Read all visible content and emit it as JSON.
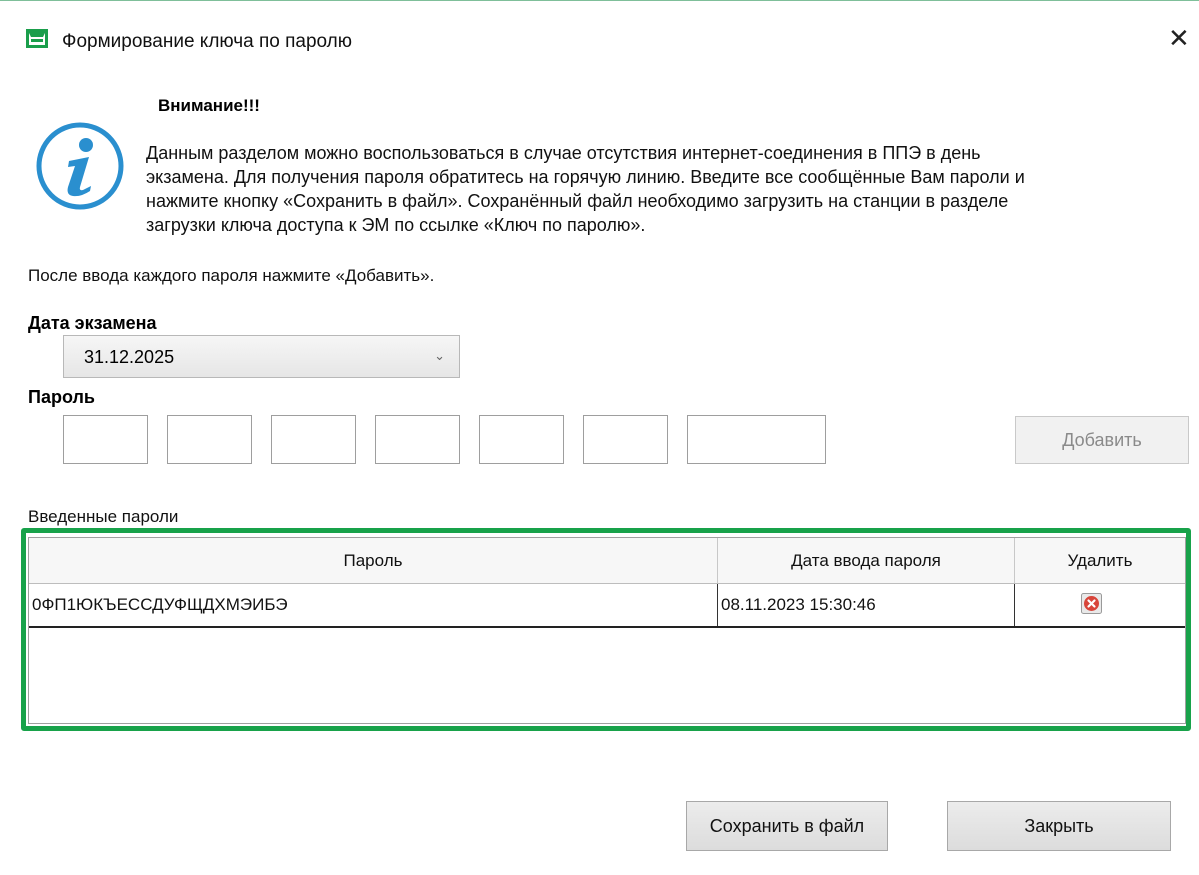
{
  "window": {
    "title": "Формирование ключа по паролю",
    "close_symbol": "✕",
    "icon": "app-window-icon"
  },
  "warning": {
    "icon": "info-icon",
    "title": "Внимание!!!",
    "lines": [
      "Данным разделом можно воспользоваться в случае отсутствия интернет-соединения в ППЭ в день",
      "экзамена. Для получения пароля обратитесь на горячую линию. Введите все сообщённые Вам пароли и",
      "нажмите кнопку «Сохранить в файл». Сохранённый файл необходимо загрузить на станции в разделе",
      "загрузки ключа доступа к ЭМ по ссылке «Ключ по паролю»."
    ]
  },
  "instruction": "После ввода каждого пароля нажмите «Добавить».",
  "exam_date": {
    "label": "Дата экзамена",
    "selected": "31.12.2025",
    "chevron": "⌄"
  },
  "password": {
    "label": "Пароль",
    "fields": [
      "",
      "",
      "",
      "",
      "",
      "",
      ""
    ],
    "add_button": "Добавить"
  },
  "entered": {
    "label": "Введенные пароли",
    "columns": [
      "Пароль",
      "Дата ввода пароля",
      "Удалить"
    ],
    "rows": [
      {
        "password": "0ФП1ЮКЪЕССДУФЩДХМЭИБЭ",
        "date": "08.11.2023 15:30:46",
        "delete_icon": "delete-icon"
      }
    ],
    "highlight_color": "#18a24a"
  },
  "buttons": {
    "save": "Сохранить в файл",
    "close": "Закрыть"
  }
}
